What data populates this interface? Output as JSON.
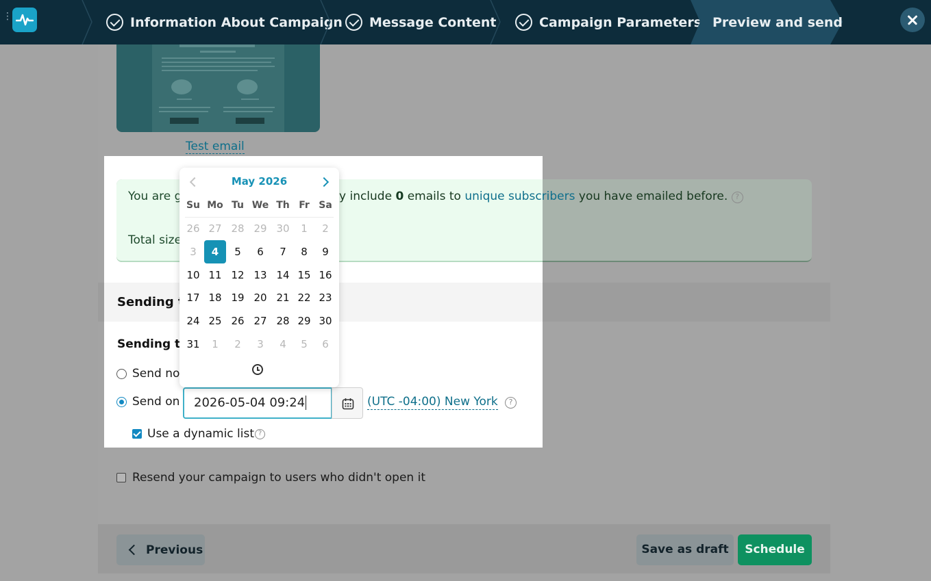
{
  "wizard": {
    "steps": [
      {
        "label": "Information About Campaign",
        "done": true
      },
      {
        "label": "Message Content",
        "done": true
      },
      {
        "label": "Campaign Parameters",
        "done": true
      },
      {
        "label": "Preview and send",
        "done": false,
        "active": true
      }
    ],
    "icons": {
      "menu": "vertical-dots-icon",
      "logo": "pulse-logo-icon",
      "close": "close-icon"
    }
  },
  "preview": {
    "test_email_link": "Test email"
  },
  "info": {
    "line1_start": "You are g",
    "line1_mid": "y include ",
    "line1_count": "0",
    "line1_after": " emails to ",
    "line1_link": "unique subscribers",
    "line1_end": " you have emailed before.",
    "line2_start": "Total size"
  },
  "sending": {
    "section_title": "Sending t",
    "subtitle": "Sending tir",
    "send_now_label": "Send no",
    "send_on_label": "Send on",
    "selected_option": "send_on",
    "datetime_value": "2026-05-04 09:24",
    "timezone_link": "(UTC -04:00) New York",
    "dynamic_list_label": "Use a dynamic list",
    "dynamic_list_checked": true,
    "resend_label": "Resend your campaign to users who didn't open it",
    "resend_checked": false
  },
  "datepicker": {
    "month_title": "May 2026",
    "weekdays": [
      "Su",
      "Mo",
      "Tu",
      "We",
      "Th",
      "Fr",
      "Sa"
    ],
    "weeks": [
      [
        "26",
        "27",
        "28",
        "29",
        "30",
        "1",
        "2"
      ],
      [
        "3",
        "4",
        "5",
        "6",
        "7",
        "8",
        "9"
      ],
      [
        "10",
        "11",
        "12",
        "13",
        "14",
        "15",
        "16"
      ],
      [
        "17",
        "18",
        "19",
        "20",
        "21",
        "22",
        "23"
      ],
      [
        "24",
        "25",
        "26",
        "27",
        "28",
        "29",
        "30"
      ],
      [
        "31",
        "1",
        "2",
        "3",
        "4",
        "5",
        "6"
      ]
    ],
    "muted": [
      [
        true,
        true,
        true,
        true,
        true,
        true,
        true
      ],
      [
        true,
        false,
        false,
        false,
        false,
        false,
        false
      ],
      [
        false,
        false,
        false,
        false,
        false,
        false,
        false
      ],
      [
        false,
        false,
        false,
        false,
        false,
        false,
        false
      ],
      [
        false,
        false,
        false,
        false,
        false,
        false,
        false
      ],
      [
        false,
        true,
        true,
        true,
        true,
        true,
        true
      ]
    ],
    "selected_day": "4",
    "accent_color": "#1692b5"
  },
  "footer": {
    "previous_label": "Previous",
    "draft_label": "Save as draft",
    "schedule_label": "Schedule",
    "schedule_color": "#0e9160"
  }
}
